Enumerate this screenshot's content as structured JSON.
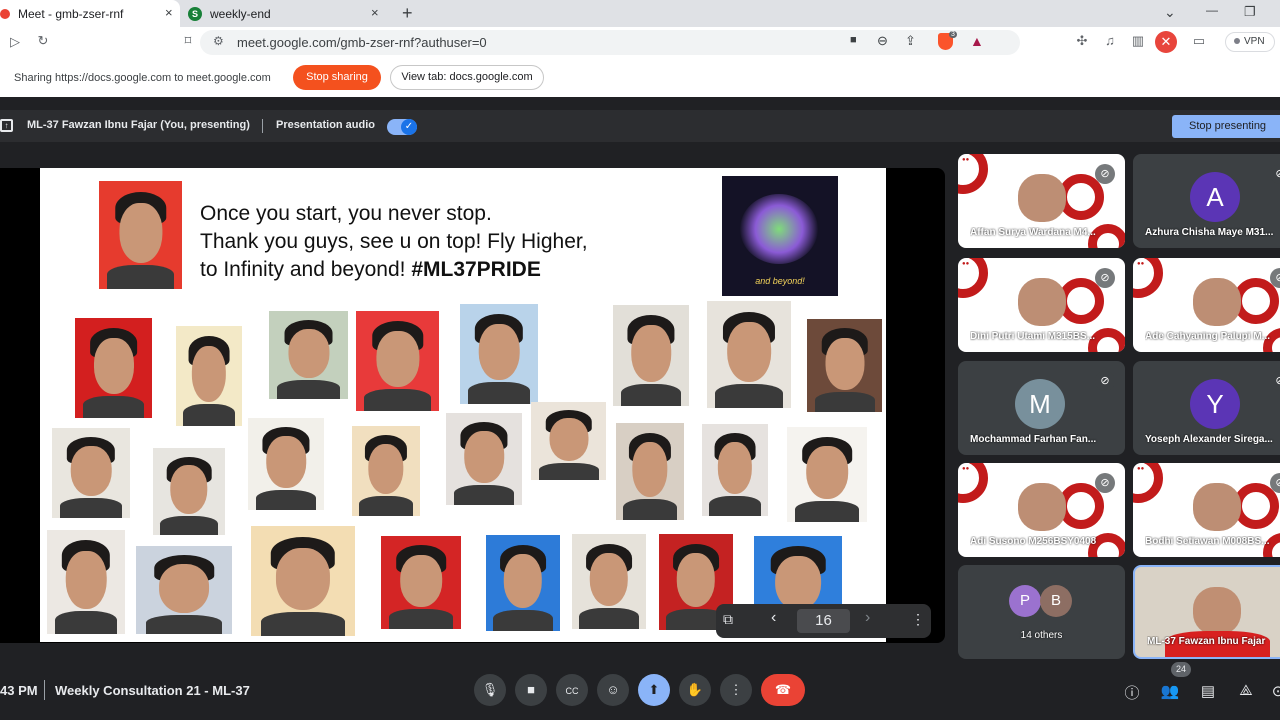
{
  "browser": {
    "tabs": [
      {
        "title": "Meet - gmb-zser-rnf",
        "favicon_color": "#ea4335",
        "close": "×"
      },
      {
        "title": "weekly-end",
        "favicon_letter": "S",
        "favicon_color": "#188038",
        "close": "×"
      }
    ],
    "new_tab": "+",
    "url": "meet.google.com/gmb-zser-rnf?authuser=0",
    "vpn_label": "VPN",
    "extension_badge": "3",
    "window_buttons": [
      "⌄",
      "—",
      "❐"
    ]
  },
  "sharing_bar": {
    "text": "Sharing https://docs.google.com to meet.google.com",
    "stop_sharing_label": "Stop sharing",
    "view_tab_label": "View tab: docs.google.com"
  },
  "meet_bar": {
    "presenting_label": "ML-37 Fawzan Ibnu Fajar (You, presenting)",
    "presentation_audio_label": "Presentation audio",
    "presentation_audio_on": true,
    "stop_presenting_label": "Stop presenting"
  },
  "slide": {
    "line1": "Once you start, you never stop.",
    "line2": "Thank you guys, see u on top! Fly Higher,",
    "line3a": "to Infinity and beyond! ",
    "line3b": "#ML37PRIDE",
    "buzz_caption": "and beyond!",
    "page_number": "16",
    "photo_bg_colors": [
      "#e63b2e",
      "#d31f1f",
      "#f3e9c7",
      "#c3d0bd",
      "#e83a3a",
      "#b9d3ea",
      "#e2dfd8",
      "#e7e3dc",
      "#6d4a3a",
      "#e9e6df",
      "#e7e5e0",
      "#f2f0ea",
      "#f1dfbf",
      "#e5e1de",
      "#ebe4da",
      "#d8cfc4",
      "#e6e2df",
      "#f5f3ef",
      "#ece8e3",
      "#cbd3de",
      "#f3ddb3",
      "#d42525",
      "#2d7bd8",
      "#e6e2da",
      "#c42222",
      "#2f7fdc",
      "#e9e5df"
    ]
  },
  "participants": [
    {
      "name": "Affan Surya Wardana M4...",
      "type": "video",
      "muted": true
    },
    {
      "name": "Azhura Chisha Maye M31...",
      "type": "avatar",
      "initial": "A",
      "color": "#5b35b5",
      "muted": true
    },
    {
      "name": "Dini Putri Utami M315BS...",
      "type": "video",
      "muted": true
    },
    {
      "name": "Ade Cahyaning Palupi M...",
      "type": "video",
      "muted": true
    },
    {
      "name": "Mochammad Farhan Fan...",
      "type": "avatar",
      "initial": "M",
      "color": "#78909c",
      "muted": true
    },
    {
      "name": "Yoseph Alexander Sirega...",
      "type": "avatar",
      "initial": "Y",
      "color": "#5b35b5",
      "muted": true
    },
    {
      "name": "Adi Susono M256BSY0408",
      "type": "video",
      "muted": true
    },
    {
      "name": "Bodhi Setiawan M008BS...",
      "type": "video",
      "muted": true
    },
    {
      "name": "14 others",
      "type": "others",
      "initials": [
        "P",
        "B"
      ]
    },
    {
      "name": "ML-37 Fawzan Ibnu Fajar",
      "type": "self"
    }
  ],
  "bottom_bar": {
    "time": "43 PM",
    "meeting_title": "Weekly Consultation 21 - ML-37",
    "people_count": "24"
  },
  "icons": {
    "mic": "mic-icon",
    "camera": "camera-icon",
    "captions": "captions-icon",
    "emoji": "emoji-icon",
    "present": "present-icon",
    "hand": "raise-hand-icon",
    "more": "more-icon",
    "end": "end-call-icon"
  }
}
